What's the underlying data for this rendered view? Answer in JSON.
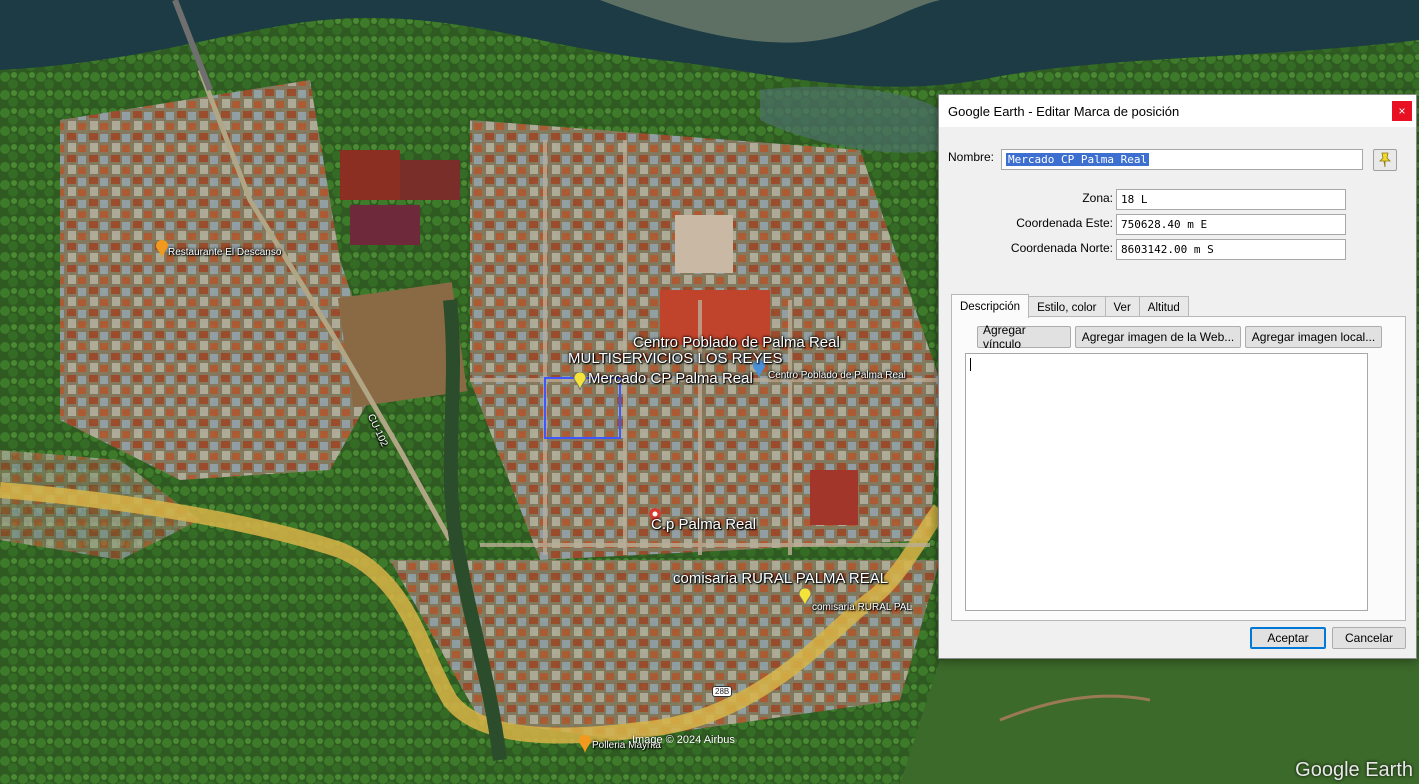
{
  "app": {
    "window_title": "Google Earth - Editar Marca de posición",
    "close_glyph": "×"
  },
  "form": {
    "name_label": "Nombre:",
    "name_value": "Mercado CP Palma Real",
    "zone_label": "Zona:",
    "zone_value": "18 L",
    "east_label": "Coordenada Este:",
    "east_value": "750628.40 m E",
    "north_label": "Coordenada Norte:",
    "north_value": "8603142.00 m S"
  },
  "tabs": [
    "Descripción",
    "Estilo, color",
    "Ver",
    "Altitud"
  ],
  "description_toolbar": {
    "add_link": "Agregar vínculo",
    "add_web_image": "Agregar imagen de la Web...",
    "add_local_image": "Agregar imagen local..."
  },
  "description_text": "",
  "footer": {
    "ok": "Aceptar",
    "cancel": "Cancelar"
  },
  "map": {
    "labels": {
      "restaurant": "Restaurante El Descanso",
      "centro_big": "Centro Poblado de Palma Real",
      "multiservicios": "MULTISERVICIOS LOS REYES",
      "mercado": "Mercado CP Palma Real",
      "centro_small": "Centro Poblado de Palma Real",
      "cp_palma": "C.p Palma Real",
      "comisaria_big": "comisaria RURAL PALMA REAL",
      "comisaria_small": "comisaria RURAL PAL",
      "polleria": "Polleria Mayrita",
      "road_cu": "CU-102",
      "road_28b": "28B"
    },
    "copyright": "Image © 2024 Airbus",
    "watermark": "Google Earth"
  }
}
